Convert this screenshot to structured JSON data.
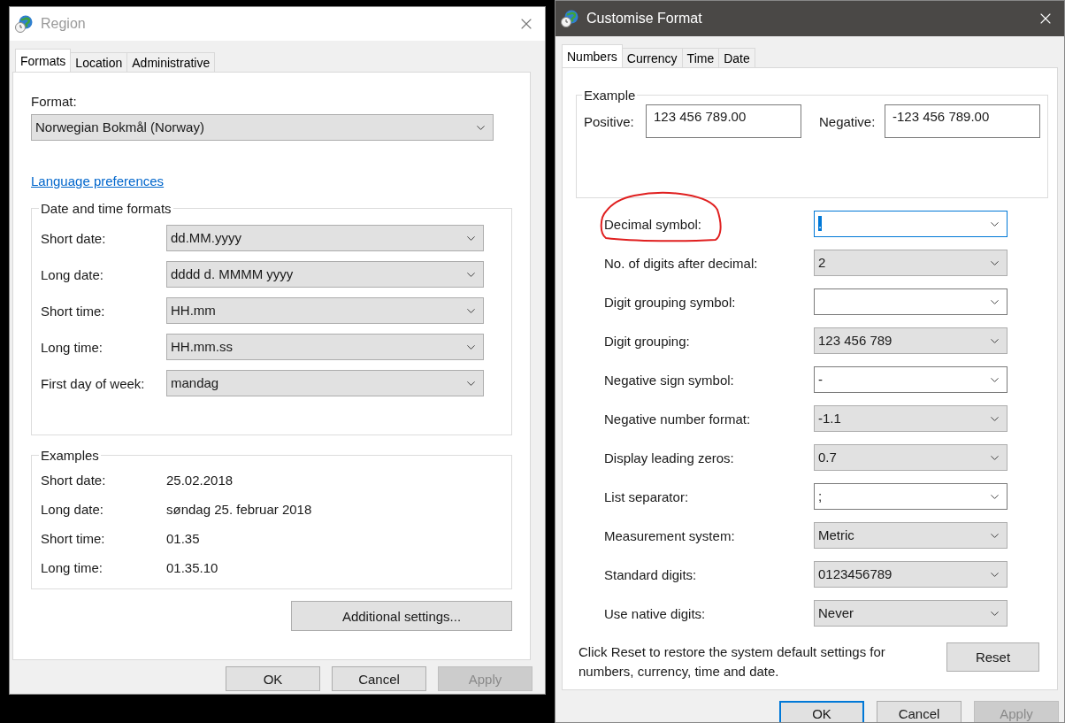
{
  "region_window": {
    "title": "Region",
    "active": false,
    "tabs": [
      {
        "label": "Formats",
        "selected": true
      },
      {
        "label": "Location",
        "selected": false
      },
      {
        "label": "Administrative",
        "selected": false
      }
    ],
    "format_label": "Format:",
    "format_value": "Norwegian Bokmål (Norway)",
    "link": "Language preferences",
    "date_time_group": {
      "title": "Date and time formats",
      "rows": [
        {
          "label": "Short date:",
          "value": "dd.MM.yyyy"
        },
        {
          "label": "Long date:",
          "value": "dddd d. MMMM yyyy"
        },
        {
          "label": "Short time:",
          "value": "HH.mm"
        },
        {
          "label": "Long time:",
          "value": "HH.mm.ss"
        },
        {
          "label": "First day of week:",
          "value": "mandag"
        }
      ]
    },
    "examples_group": {
      "title": "Examples",
      "rows": [
        {
          "label": "Short date:",
          "value": "25.02.2018"
        },
        {
          "label": "Long date:",
          "value": "søndag 25. februar 2018"
        },
        {
          "label": "Short time:",
          "value": "01.35"
        },
        {
          "label": "Long time:",
          "value": "01.35.10"
        }
      ]
    },
    "additional_button": "Additional settings...",
    "buttons": [
      {
        "label": "OK",
        "disabled": false,
        "default": false
      },
      {
        "label": "Cancel",
        "disabled": false,
        "default": false
      },
      {
        "label": "Apply",
        "disabled": true,
        "default": false
      }
    ]
  },
  "customise_window": {
    "title": "Customise Format",
    "active": true,
    "tabs": [
      {
        "label": "Numbers",
        "selected": true
      },
      {
        "label": "Currency",
        "selected": false
      },
      {
        "label": "Time",
        "selected": false
      },
      {
        "label": "Date",
        "selected": false
      }
    ],
    "example_group": {
      "title": "Example",
      "positive_label": "Positive:",
      "positive_value": "123 456 789.00",
      "negative_label": "Negative:",
      "negative_value": "-123 456 789.00"
    },
    "settings": [
      {
        "label": "Decimal symbol:",
        "value": ".",
        "kind": "combo",
        "focused": true,
        "circled": true
      },
      {
        "label": "No. of digits after decimal:",
        "value": "2",
        "kind": "list",
        "focused": false,
        "circled": false
      },
      {
        "label": "Digit grouping symbol:",
        "kind": "combo",
        "focused": false,
        "circled": false
      },
      {
        "label": "Digit grouping:",
        "value": "123 456 789",
        "kind": "list",
        "focused": false,
        "circled": false
      },
      {
        "label": "Negative sign symbol:",
        "value": "-",
        "kind": "combo",
        "focused": false,
        "circled": false
      },
      {
        "label": "Negative number format:",
        "value": "-1.1",
        "kind": "list",
        "focused": false,
        "circled": false
      },
      {
        "label": "Display leading zeros:",
        "value": "0.7",
        "kind": "list",
        "focused": false,
        "circled": false
      },
      {
        "label": "List separator:",
        "value": ";",
        "kind": "combo",
        "focused": false,
        "circled": false
      },
      {
        "label": "Measurement system:",
        "value": "Metric",
        "kind": "list",
        "focused": false,
        "circled": false
      },
      {
        "label": "Standard digits:",
        "value": "0123456789",
        "kind": "list",
        "focused": false,
        "circled": false
      },
      {
        "label": "Use native digits:",
        "value": "Never",
        "kind": "list",
        "focused": false,
        "circled": false
      }
    ],
    "reset_note": "Click Reset to restore the system default settings for numbers, currency, time and date.",
    "reset_button": "Reset",
    "buttons": [
      {
        "label": "OK",
        "disabled": false,
        "default": true
      },
      {
        "label": "Cancel",
        "disabled": false,
        "default": false
      },
      {
        "label": "Apply",
        "disabled": true,
        "default": false
      }
    ]
  }
}
